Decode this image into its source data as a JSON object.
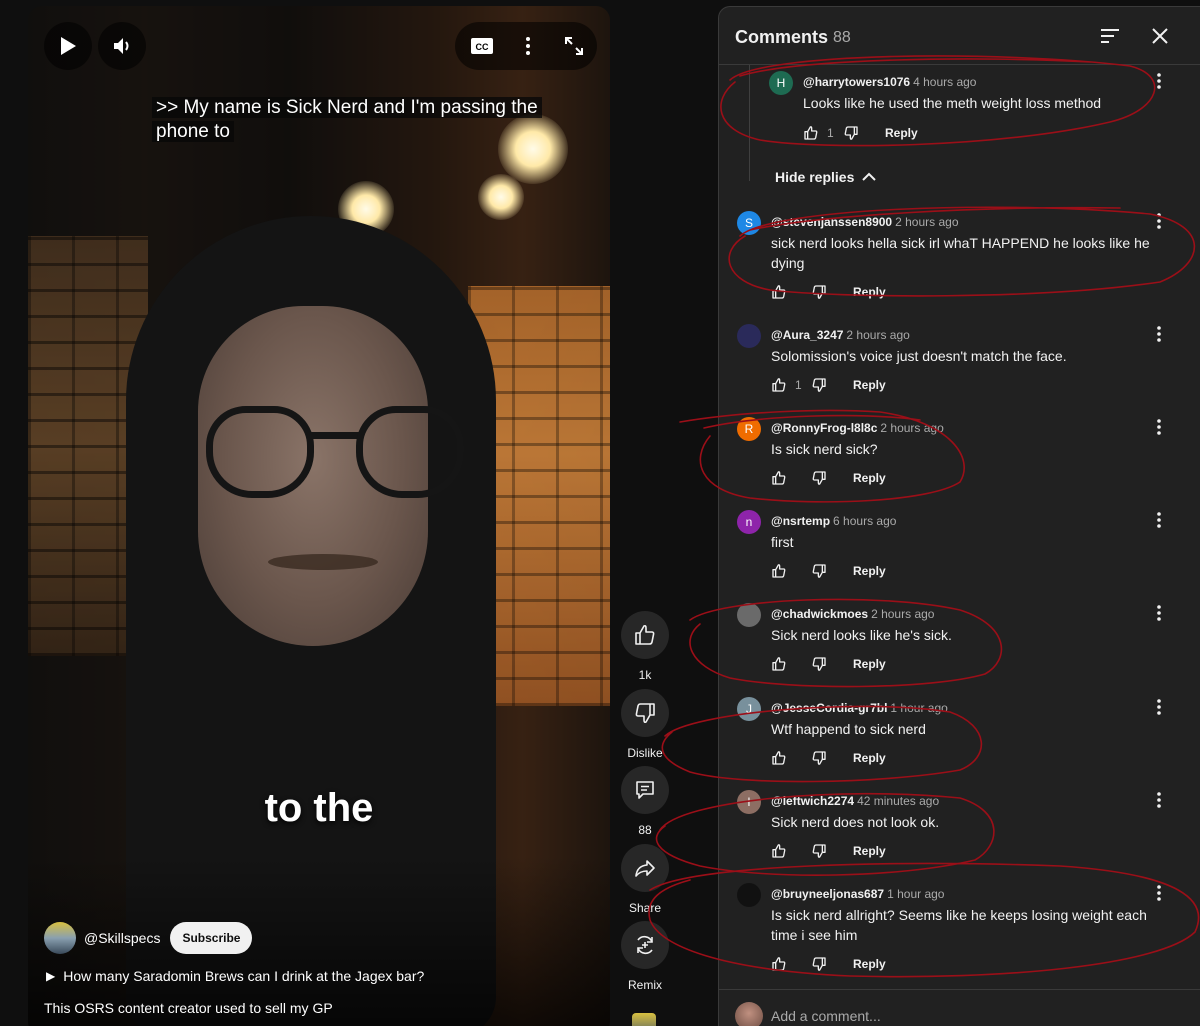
{
  "player": {
    "caption_line": ">> My name is Sick Nerd and I'm passing the phone to",
    "caption_overlay": "to the",
    "channel": "@Skillspecs",
    "subscribe_label": "Subscribe",
    "related": "How many Saradomin Brews can I drink at the Jagex bar?",
    "description": "This OSRS content creator used to sell my GP",
    "icons": [
      "play-icon",
      "volume-icon",
      "closed-captions-icon",
      "more-vert-icon",
      "fullscreen-icon"
    ]
  },
  "actions": {
    "like_count": "1k",
    "dislike_label": "Dislike",
    "comments_count": "88",
    "share_label": "Share",
    "remix_label": "Remix"
  },
  "comments_panel": {
    "title": "Comments",
    "count": "88",
    "hide_replies": "Hide replies",
    "add_placeholder": "Add a comment...",
    "comments": [
      {
        "author": "@harrytowers1076",
        "time": "4 hours ago",
        "text": "Looks like he used the meth weight loss method",
        "likes": "1",
        "reply": "Reply",
        "avatar_letter": "H",
        "avatar_color": "#1e6b52"
      },
      {
        "author": "@stevenjanssen8900",
        "time": "2 hours ago",
        "text": "sick nerd looks   hella sick irl whaT HAPPEND   he looks like he dying",
        "likes": "",
        "reply": "Reply",
        "avatar_letter": "S",
        "avatar_color": "#1e88e5"
      },
      {
        "author": "@Aura_3247",
        "time": "2 hours ago",
        "text": "Solomission's voice just doesn't match the face.",
        "likes": "1",
        "reply": "Reply",
        "avatar_letter": "",
        "avatar_color": "#2a2a5a"
      },
      {
        "author": "@RonnyFrog-l8l8c",
        "time": "2 hours ago",
        "text": "Is sick nerd sick?",
        "likes": "",
        "reply": "Reply",
        "avatar_letter": "R",
        "avatar_color": "#ef6c00"
      },
      {
        "author": "@nsrtemp",
        "time": "6 hours ago",
        "text": "first",
        "likes": "",
        "reply": "Reply",
        "avatar_letter": "n",
        "avatar_color": "#8e24aa"
      },
      {
        "author": "@chadwickmoes",
        "time": "2 hours ago",
        "text": "Sick nerd looks like he's sick.",
        "likes": "",
        "reply": "Reply",
        "avatar_letter": "",
        "avatar_color": "#6a6a6a"
      },
      {
        "author": "@JesseCordia-gr7bl",
        "time": "1 hour ago",
        "text": "Wtf happend to sick nerd",
        "likes": "",
        "reply": "Reply",
        "avatar_letter": "J",
        "avatar_color": "#78909c"
      },
      {
        "author": "@leftwich2274",
        "time": "42 minutes ago",
        "text": "Sick nerd does not look ok.",
        "likes": "",
        "reply": "Reply",
        "avatar_letter": "l",
        "avatar_color": "#8d6e63"
      },
      {
        "author": "@bruyneeljonas687",
        "time": "1 hour ago",
        "text": "Is sick nerd allright? Seems like he keeps losing weight each time i see him",
        "likes": "",
        "reply": "Reply",
        "avatar_letter": "",
        "avatar_color": "#111111"
      }
    ]
  },
  "colors": {
    "annotation": "#9b0f18",
    "panel_bg": "#212121",
    "page_bg": "#0f0f0f"
  }
}
